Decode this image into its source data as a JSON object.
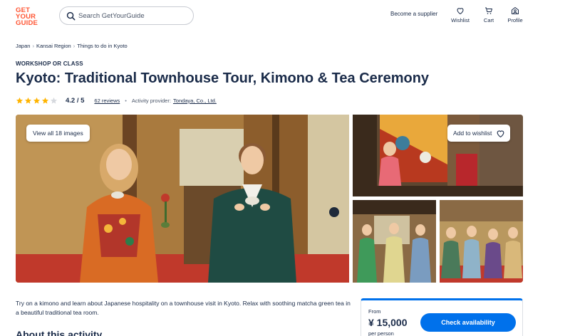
{
  "header": {
    "logo_lines": [
      "GET",
      "YOUR",
      "GUIDE"
    ],
    "search_placeholder": "Search GetYourGuide",
    "supplier_link": "Become a supplier",
    "nav": [
      {
        "label": "Wishlist",
        "icon": "heart-icon"
      },
      {
        "label": "Cart",
        "icon": "cart-icon"
      },
      {
        "label": "Profile",
        "icon": "profile-icon"
      }
    ]
  },
  "breadcrumb": [
    "Japan",
    "Kansai Region",
    "Things to do in Kyoto"
  ],
  "activity": {
    "category": "WORKSHOP OR CLASS",
    "title": "Kyoto: Traditional Townhouse Tour, Kimono & Tea Ceremony",
    "rating": 4.2,
    "rating_text": "4.2 / 5",
    "stars_filled": 4,
    "stars_total": 5,
    "reviews_text": "62 reviews",
    "provider_label": "Activity provider:",
    "provider_name": "Tondaya, Co., Ltd."
  },
  "gallery": {
    "view_all_label": "View all 18 images",
    "wishlist_label": "Add to wishlist"
  },
  "intro_text": "Try on a kimono and learn about Japanese hospitality on a townhouse visit in Kyoto. Relax with soothing matcha green tea in a beautiful traditional tea room.",
  "about_heading": "About this activity",
  "booking": {
    "from_label": "From",
    "price": "¥ 15,000",
    "per_label": "per person",
    "cta_label": "Check availability"
  },
  "colors": {
    "brand": "#ff5533",
    "primary": "#0071eb",
    "text": "#1a2b49",
    "star": "#ffb400"
  }
}
